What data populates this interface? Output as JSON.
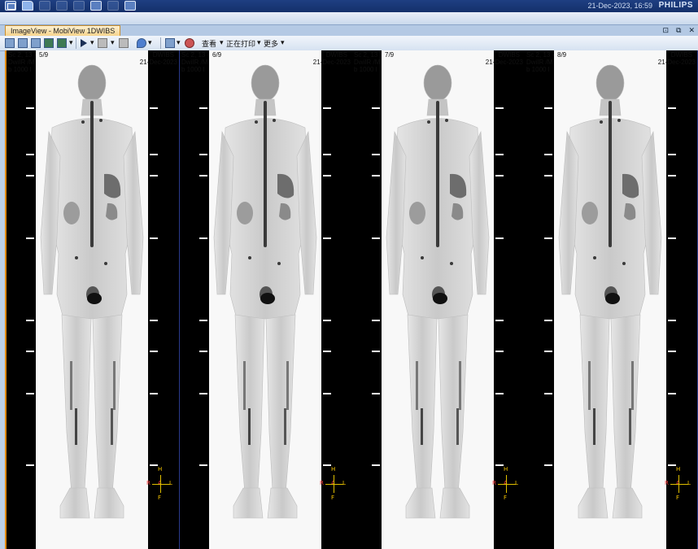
{
  "system_bar": {
    "datetime": "21-Dec-2023, 16:59",
    "brand": "PHILIPS"
  },
  "tab": {
    "label": "ImageView - MobiView 1DWIBS"
  },
  "toolbar": {
    "view_menu": "查看",
    "printing_menu": "正在打印",
    "more_menu": "更多"
  },
  "window_controls": [
    "⊡",
    "⧉",
    "✕"
  ],
  "panes": [
    {
      "series": "Sc 2, 13 -",
      "protocol": "DwiIR   /M",
      "bvalue": "b 1000 l",
      "image_index": "5/9",
      "modality": "DWIBS",
      "date": "21-Dec-2023",
      "orientation": {
        "top": "H",
        "left": "R",
        "center": "A",
        "right": "L",
        "bottom": "F"
      }
    },
    {
      "series": "Sc 2, 13 -",
      "protocol": "DwiIR   /M",
      "bvalue": "b 1000 l",
      "image_index": "6/9",
      "modality": "DWIBS",
      "date": "21-Dec-2023",
      "orientation": {
        "top": "H",
        "left": "R",
        "center": "A",
        "right": "L",
        "bottom": "F"
      }
    },
    {
      "series": "Sc 2, 13 -",
      "protocol": "DwiIR   /M",
      "bvalue": "b 1000 l",
      "image_index": "7/9",
      "modality": "DWIBS",
      "date": "21-Dec-2023",
      "orientation": {
        "top": "H",
        "left": "R",
        "center": "A",
        "right": "L",
        "bottom": "F"
      }
    },
    {
      "series": "Sc 2, 13 -",
      "protocol": "DwiIR   /M",
      "bvalue": "b 1000 l",
      "image_index": "8/9",
      "modality": "DWIBS",
      "date": "21-Dec-2023",
      "orientation": {
        "top": "H",
        "left": "R",
        "center": "A",
        "right": "L",
        "bottom": "F"
      }
    }
  ],
  "colors": {
    "accent_tab": "#f6d38b",
    "accent_border": "#e08a10",
    "titlebar": "#14306a"
  }
}
